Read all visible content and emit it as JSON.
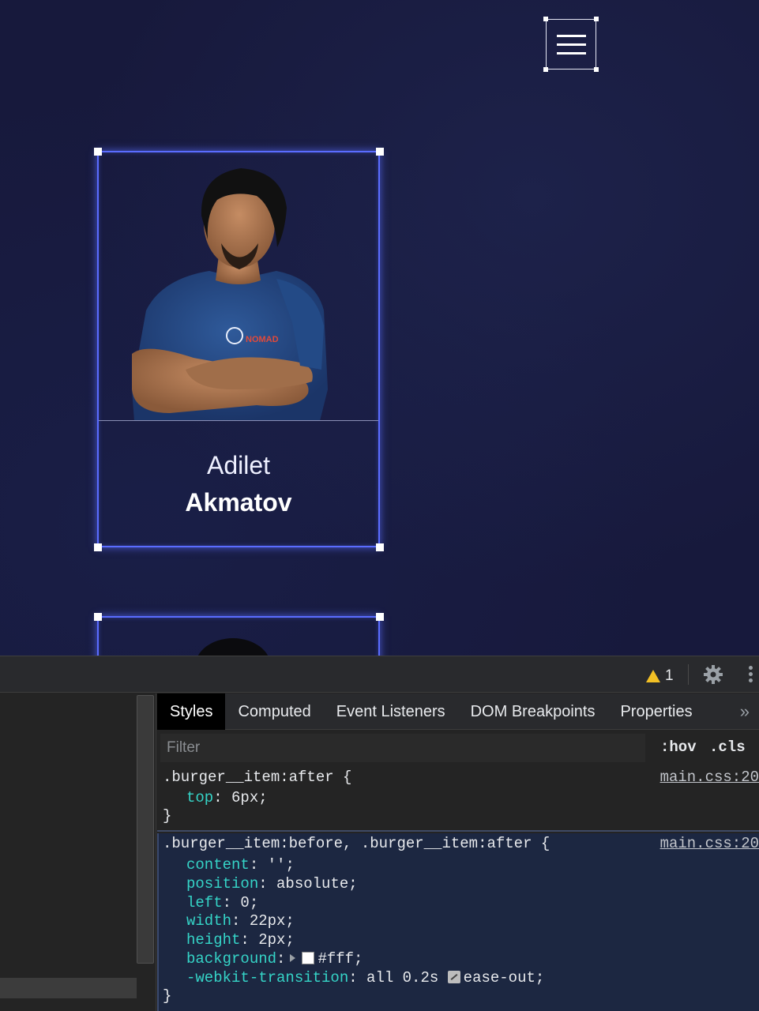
{
  "page": {
    "card1": {
      "first_name": "Adilet",
      "last_name": "Akmatov",
      "photo_icon": "person-photo"
    }
  },
  "devtools": {
    "warning_count": "1",
    "tabs": [
      "Styles",
      "Computed",
      "Event Listeners",
      "DOM Breakpoints",
      "Properties"
    ],
    "more_tabs": "»",
    "filter_placeholder": "Filter",
    "hov": ":hov",
    "cls": ".cls",
    "rule1": {
      "selector": ".burger__item:after {",
      "source": "main.css:20",
      "declarations": [
        {
          "prop": "top",
          "value": " 6px;"
        }
      ],
      "close": "}"
    },
    "rule2": {
      "selector": ".burger__item:before, .burger__item:after {",
      "source": "main.css:20",
      "declarations": [
        {
          "prop": "content",
          "value": " '';"
        },
        {
          "prop": "position",
          "value": " absolute;"
        },
        {
          "prop": "left",
          "value": " 0;"
        },
        {
          "prop": "width",
          "value": " 22px;"
        },
        {
          "prop": "height",
          "value": " 2px;"
        },
        {
          "prop": "background",
          "value": "#fff;"
        },
        {
          "prop": "-webkit-transition",
          "value_pre": " all 0.2s ",
          "value_post": "ease-out;"
        }
      ],
      "close": "}"
    },
    "colors": {
      "accent_prop": "#35d4c7",
      "card_glow": "#5a6cff",
      "warning": "#f2c025"
    }
  }
}
